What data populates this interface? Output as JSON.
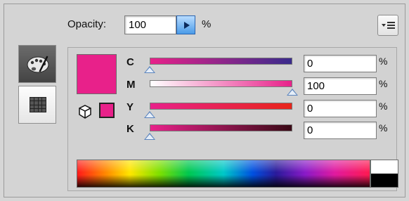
{
  "opacity": {
    "label": "Opacity:",
    "value": "100",
    "unit": "%"
  },
  "tabs": {
    "color_icon": "palette-icon",
    "swatches_icon": "grid-icon"
  },
  "current_color": "#e8218a",
  "channels": [
    {
      "label": "C",
      "value": "0",
      "unit": "%",
      "level": 0,
      "gradient": [
        "#e8218a",
        "#3a2b8c"
      ]
    },
    {
      "label": "M",
      "value": "100",
      "unit": "%",
      "level": 1,
      "gradient": [
        "#ffffff",
        "#e8218a"
      ]
    },
    {
      "label": "Y",
      "value": "0",
      "unit": "%",
      "level": 0,
      "gradient": [
        "#e8218a",
        "#e8251a"
      ]
    },
    {
      "label": "K",
      "value": "0",
      "unit": "%",
      "level": 0,
      "gradient": [
        "#e8218a",
        "#3a0a16"
      ]
    }
  ]
}
